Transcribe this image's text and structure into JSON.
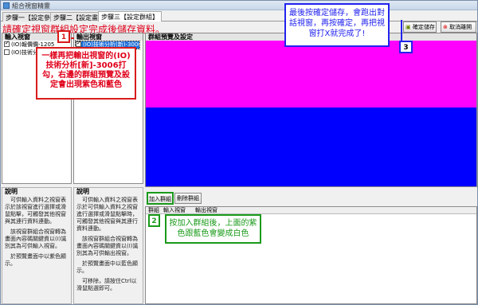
{
  "window": {
    "title": "組合視窗精靈"
  },
  "tabs": [
    {
      "label": "步驟一【設定參數】"
    },
    {
      "label": "步驟二【設定畫面】"
    },
    {
      "label": "步驟三【設定群組】"
    }
  ],
  "instruction": "請確定視窗群組設定完成後儲存資料。",
  "input_panel": {
    "header": "輸入視窗",
    "items": [
      {
        "label": "(IO)報價價-1205",
        "checked": true
      },
      {
        "label": "(IO)技術分析(新)-3006",
        "checked": false
      }
    ]
  },
  "output_panel": {
    "header": "輸出視窗",
    "items": [
      {
        "label": "(IO)技術分析(新)-3006",
        "checked": true
      }
    ]
  },
  "preview_panel": {
    "header": "群組預覽及設定",
    "colors": {
      "top": "#ff00ff",
      "bottom": "#0000ff"
    }
  },
  "left_desc": {
    "header": "說明",
    "paragraphs": [
      "可供輸入資料之視窗表示於該視窗進行選擇或滑鼠點擊，可觸發其他視窗與其連行資料連動。",
      "該視窗群組合視窗轉為畫面內容碼關鍵資以(I)識別其為可供輸入視窗。",
      "於預覽畫面中以紫色顯示。"
    ]
  },
  "right_desc": {
    "header": "說明",
    "paragraphs": [
      "可供輸入資料之視窗表示於可供輸入資料之視窗進行選擇或滑鼠點擊時，可觸發其他視窗與其連行資料連動。",
      "該視窗群組合視窗轉為畫面內容碼關鍵資以(I)識別其為可供輸出視窗。",
      "於預覽畫面中以藍色顯示。",
      "可移除，請按住Ctrl以滑鼠點選即可。"
    ]
  },
  "buttons": {
    "add_group": "加入群組",
    "remove_group": "刪除群組",
    "save": "確定儲存",
    "cancel": "取消離開"
  },
  "table": {
    "columns": [
      "群組",
      "輸入視窗",
      "輸出視窗"
    ]
  },
  "annotations": {
    "red": {
      "number": "1",
      "text": "一樣再把輸出視窗的(IO)技術分析[新]-3006打勾，右邊的群組預覽及設定會出現紫色和藍色"
    },
    "blue": {
      "number": "3",
      "text": "最後按確定儲存，會跑出對話視窗，再按確定，再把視窗打X就完成了!"
    },
    "green": {
      "number": "2",
      "text": "按加入群組後，上面的紫色跟藍色會變成白色"
    }
  }
}
